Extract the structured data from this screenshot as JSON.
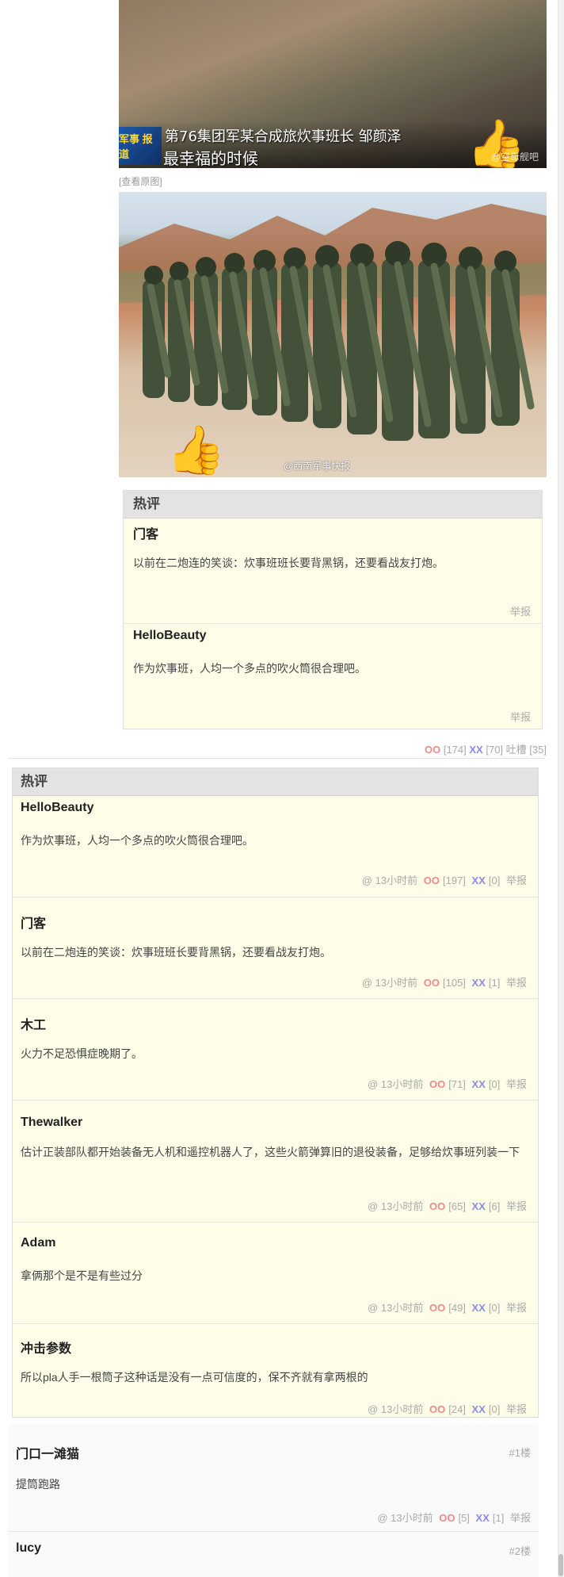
{
  "post": {
    "image1": {
      "caption_line1": "第76集团军某合成旅炊事班长  邹颜泽",
      "caption_line2": "最幸福的时候",
      "logo_text": "军事\n报道",
      "watermark": "@空母舰吧"
    },
    "view_original": "[查看原图]",
    "image2": {
      "watermark": "@西南军事快报"
    },
    "hot_comments_header": "热评",
    "hot_comments": [
      {
        "author": "门客",
        "text": "以前在二炮连的笑谈：炊事班班长要背黑锅，还要看战友打炮。",
        "report": "举报"
      },
      {
        "author": "HelloBeauty",
        "text": "作为炊事班，人均一个多点的吹火筒很合理吧。",
        "report": "举报"
      }
    ],
    "votes": {
      "oo_label": "OO",
      "oo_count": "[174]",
      "xx_label": "XX",
      "xx_count": "[70]",
      "tucao_label": "吐槽",
      "tucao_count": "[35]"
    }
  },
  "hot_list": {
    "header": "热评",
    "items": [
      {
        "author": "HelloBeauty",
        "text": "作为炊事班，人均一个多点的吹火筒很合理吧。",
        "time": "@ 13小时前",
        "oo": "OO",
        "oo_count": "[197]",
        "xx": "XX",
        "xx_count": "[0]",
        "report": "举报"
      },
      {
        "author": "门客",
        "text": "以前在二炮连的笑谈：炊事班班长要背黑锅，还要看战友打炮。",
        "time": "@ 13小时前",
        "oo": "OO",
        "oo_count": "[105]",
        "xx": "XX",
        "xx_count": "[1]",
        "report": "举报"
      },
      {
        "author": "木工",
        "text": "火力不足恐惧症晚期了。",
        "time": "@ 13小时前",
        "oo": "OO",
        "oo_count": "[71]",
        "xx": "XX",
        "xx_count": "[0]",
        "report": "举报"
      },
      {
        "author": "Thewalker",
        "text": "估计正装部队都开始装备无人机和遥控机器人了，这些火箭弹算旧的退役装备，足够给炊事班列装一下",
        "time": "@ 13小时前",
        "oo": "OO",
        "oo_count": "[65]",
        "xx": "XX",
        "xx_count": "[6]",
        "report": "举报"
      },
      {
        "author": "Adam",
        "text": "拿俩那个是不是有些过分",
        "time": "@ 13小时前",
        "oo": "OO",
        "oo_count": "[49]",
        "xx": "XX",
        "xx_count": "[0]",
        "report": "举报"
      },
      {
        "author": "冲击参数",
        "text": "所以pla人手一根筒子这种话是没有一点可信度的，保不齐就有拿两根的",
        "time": "@ 13小时前",
        "oo": "OO",
        "oo_count": "[24]",
        "xx": "XX",
        "xx_count": "[0]",
        "report": "举报"
      }
    ]
  },
  "floors": [
    {
      "author": "门口一滩猫",
      "floor": "#1楼",
      "text": "提筒跑路",
      "time": "@ 13小时前",
      "oo": "OO",
      "oo_count": "[5]",
      "xx": "XX",
      "xx_count": "[1]",
      "report": "举报"
    },
    {
      "author": "lucy",
      "floor": "#2楼"
    }
  ]
}
